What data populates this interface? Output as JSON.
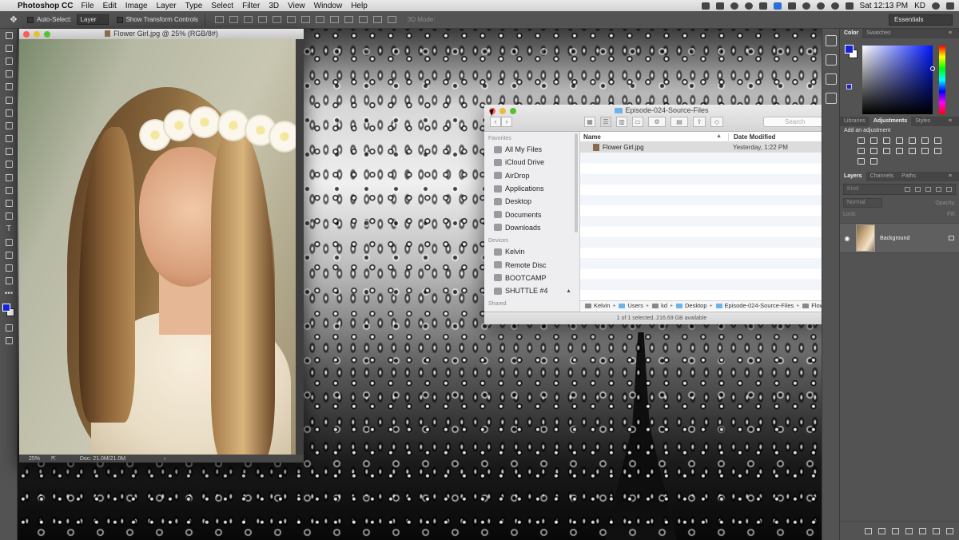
{
  "menubar": {
    "app_name": "Photoshop CC",
    "items": [
      "File",
      "Edit",
      "Image",
      "Layer",
      "Type",
      "Select",
      "Filter",
      "3D",
      "View",
      "Window",
      "Help"
    ],
    "clock": "Sat 12:13 PM",
    "user": "KD"
  },
  "options_bar": {
    "auto_select_label": "Auto-Select:",
    "auto_select_value": "Layer",
    "transform_label": "Show Transform Controls",
    "mode_label": "3D Mode:",
    "workspace": "Essentials"
  },
  "document": {
    "title": "Flower Girl.jpg @ 25% (RGB/8#)",
    "zoom": "25%",
    "doc_info": "Doc: 21.0M/21.0M"
  },
  "finder": {
    "title": "Episode-024-Source-Files",
    "search_placeholder": "Search",
    "sidebar": {
      "favorites_header": "Favorites",
      "favorites": [
        "All My Files",
        "iCloud Drive",
        "AirDrop",
        "Applications",
        "Desktop",
        "Documents",
        "Downloads"
      ],
      "devices_header": "Devices",
      "devices": [
        "Kelvin",
        "Remote Disc",
        "BOOTCAMP",
        "SHUTTLE #4"
      ],
      "shared_header": "Shared"
    },
    "columns": {
      "name": "Name",
      "date_modified": "Date Modified"
    },
    "files": [
      {
        "name": "Flower Girl.jpg",
        "date": "Yesterday, 1:22 PM"
      }
    ],
    "path": [
      "Kelvin",
      "Users",
      "kd",
      "Desktop",
      "Episode-024-Source-Files",
      "Flower Girl."
    ],
    "status": "1 of 1 selected, 216.69 GB available"
  },
  "panels": {
    "color_tabs": [
      "Color",
      "Swatches"
    ],
    "adjust_tabs": [
      "Libraries",
      "Adjustments",
      "Styles"
    ],
    "add_adjustment": "Add an adjustment",
    "layer_tabs": [
      "Layers",
      "Channels",
      "Paths"
    ],
    "kind_placeholder": "Kind",
    "blend_mode": "Normal",
    "opacity_label": "Opacity:",
    "lock_label": "Lock:",
    "fill_label": "Fill:",
    "layer_name": "Background"
  },
  "colors": {
    "foreground": "#1524d9",
    "background": "#ffffff"
  }
}
